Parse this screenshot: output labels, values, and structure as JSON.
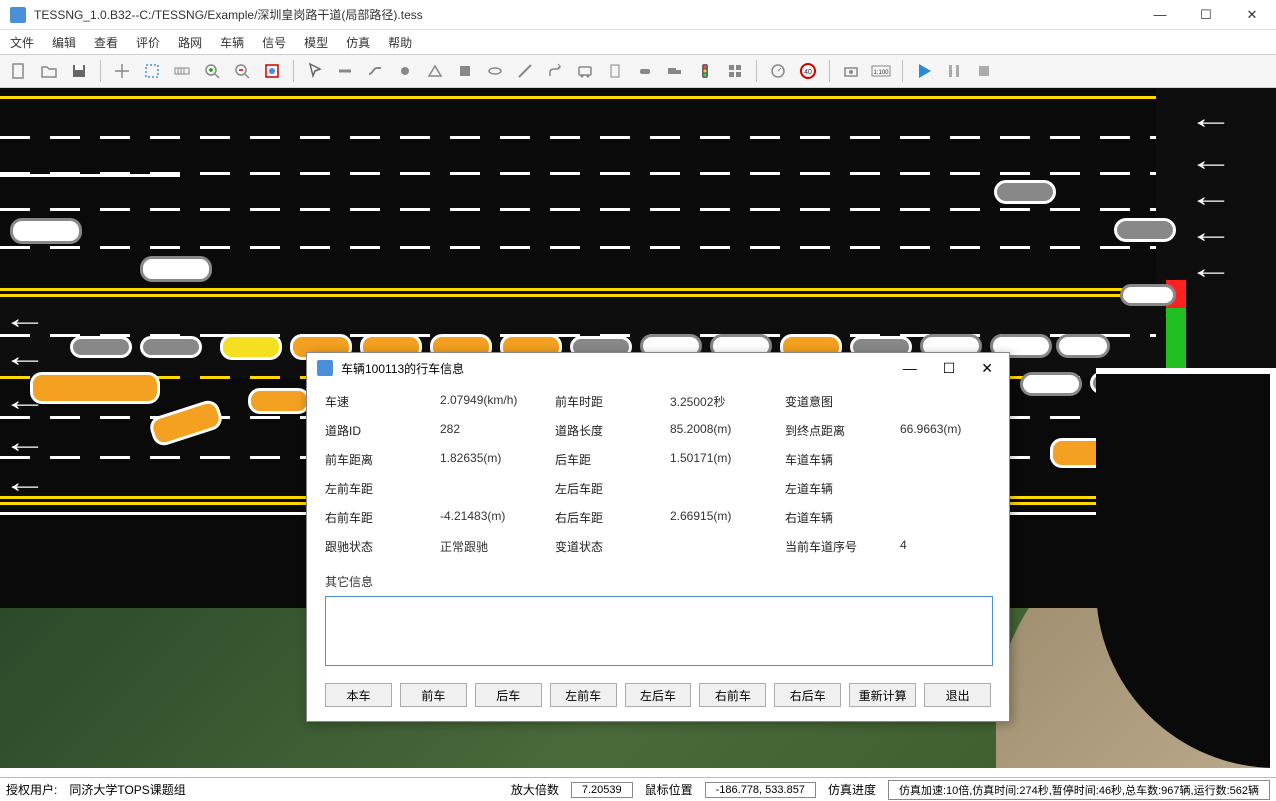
{
  "window": {
    "title": "TESSNG_1.0.B32--C:/TESSNG/Example/深圳皇岗路干道(局部路径).tess"
  },
  "menu": {
    "file": "文件",
    "edit": "编辑",
    "view": "查看",
    "eval": "评价",
    "road": "路网",
    "vehicle": "车辆",
    "signal": "信号",
    "model": "模型",
    "sim": "仿真",
    "help": "帮助"
  },
  "dialog": {
    "title": "车辆100113的行车信息",
    "fields": {
      "speed_l": "车速",
      "speed_v": "2.07949(km/h)",
      "front_time_l": "前车时距",
      "front_time_v": "3.25002秒",
      "lane_intent_l": "变道意图",
      "lane_intent_v": "",
      "road_id_l": "道路ID",
      "road_id_v": "282",
      "road_len_l": "道路长度",
      "road_len_v": "85.2008(m)",
      "to_end_l": "到终点距离",
      "to_end_v": "66.9663(m)",
      "front_dist_l": "前车距离",
      "front_dist_v": "1.82635(m)",
      "rear_dist_l": "后车距",
      "rear_dist_v": "1.50171(m)",
      "lane_veh_l": "车道车辆",
      "lane_veh_v": "",
      "lf_l": "左前车距",
      "lf_v": "",
      "lr_l": "左后车距",
      "lr_v": "",
      "left_lane_l": "左道车辆",
      "left_lane_v": "",
      "rf_l": "右前车距",
      "rf_v": "-4.21483(m)",
      "rr_l": "右后车距",
      "rr_v": "2.66915(m)",
      "right_lane_l": "右道车辆",
      "right_lane_v": "",
      "follow_l": "跟驰状态",
      "follow_v": "正常跟驰",
      "lc_state_l": "变道状态",
      "lc_state_v": "",
      "cur_lane_l": "当前车道序号",
      "cur_lane_v": "4"
    },
    "other_label": "其它信息",
    "other_value": "",
    "buttons": {
      "self": "本车",
      "front": "前车",
      "rear": "后车",
      "lf": "左前车",
      "lr": "左后车",
      "rf": "右前车",
      "rr": "右后车",
      "recalc": "重新计算",
      "exit": "退出"
    }
  },
  "status": {
    "auth_user_l": "授权用户:",
    "auth_user_v": "同济大学TOPS课题组",
    "zoom_l": "放大倍数",
    "zoom_v": "7.20539",
    "mouse_l": "鼠标位置",
    "mouse_v": "-186.778, 533.857",
    "progress_l": "仿真进度",
    "detail": "仿真加速:10倍,仿真时间:274秒,暂停时间:46秒,总车数:967辆,运行数:562辆"
  }
}
